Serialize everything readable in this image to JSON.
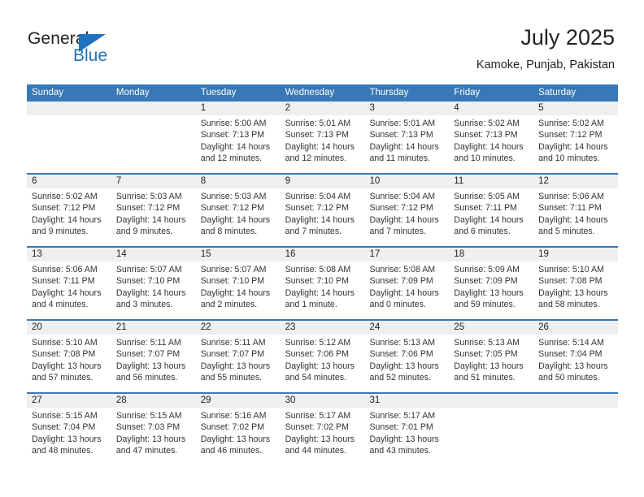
{
  "brand": {
    "name_part1": "General",
    "name_part2": "Blue",
    "flag_icon": "blue-triangle-flag",
    "accent_color": "#1f72bd"
  },
  "header": {
    "title": "July 2025",
    "subtitle": "Kamoke, Punjab, Pakistan"
  },
  "colors": {
    "header_blue": "#3878b6",
    "daynum_band": "#efefef",
    "text": "#222222"
  },
  "weekdays": [
    "Sunday",
    "Monday",
    "Tuesday",
    "Wednesday",
    "Thursday",
    "Friday",
    "Saturday"
  ],
  "weeks": [
    [
      {
        "day": "",
        "empty": true,
        "lines": []
      },
      {
        "day": "",
        "empty": true,
        "lines": []
      },
      {
        "day": "1",
        "empty": false,
        "lines": [
          "Sunrise: 5:00 AM",
          "Sunset: 7:13 PM",
          "Daylight: 14 hours",
          "and 12 minutes."
        ]
      },
      {
        "day": "2",
        "empty": false,
        "lines": [
          "Sunrise: 5:01 AM",
          "Sunset: 7:13 PM",
          "Daylight: 14 hours",
          "and 12 minutes."
        ]
      },
      {
        "day": "3",
        "empty": false,
        "lines": [
          "Sunrise: 5:01 AM",
          "Sunset: 7:13 PM",
          "Daylight: 14 hours",
          "and 11 minutes."
        ]
      },
      {
        "day": "4",
        "empty": false,
        "lines": [
          "Sunrise: 5:02 AM",
          "Sunset: 7:13 PM",
          "Daylight: 14 hours",
          "and 10 minutes."
        ]
      },
      {
        "day": "5",
        "empty": false,
        "lines": [
          "Sunrise: 5:02 AM",
          "Sunset: 7:12 PM",
          "Daylight: 14 hours",
          "and 10 minutes."
        ]
      }
    ],
    [
      {
        "day": "6",
        "empty": false,
        "lines": [
          "Sunrise: 5:02 AM",
          "Sunset: 7:12 PM",
          "Daylight: 14 hours",
          "and 9 minutes."
        ]
      },
      {
        "day": "7",
        "empty": false,
        "lines": [
          "Sunrise: 5:03 AM",
          "Sunset: 7:12 PM",
          "Daylight: 14 hours",
          "and 9 minutes."
        ]
      },
      {
        "day": "8",
        "empty": false,
        "lines": [
          "Sunrise: 5:03 AM",
          "Sunset: 7:12 PM",
          "Daylight: 14 hours",
          "and 8 minutes."
        ]
      },
      {
        "day": "9",
        "empty": false,
        "lines": [
          "Sunrise: 5:04 AM",
          "Sunset: 7:12 PM",
          "Daylight: 14 hours",
          "and 7 minutes."
        ]
      },
      {
        "day": "10",
        "empty": false,
        "lines": [
          "Sunrise: 5:04 AM",
          "Sunset: 7:12 PM",
          "Daylight: 14 hours",
          "and 7 minutes."
        ]
      },
      {
        "day": "11",
        "empty": false,
        "lines": [
          "Sunrise: 5:05 AM",
          "Sunset: 7:11 PM",
          "Daylight: 14 hours",
          "and 6 minutes."
        ]
      },
      {
        "day": "12",
        "empty": false,
        "lines": [
          "Sunrise: 5:06 AM",
          "Sunset: 7:11 PM",
          "Daylight: 14 hours",
          "and 5 minutes."
        ]
      }
    ],
    [
      {
        "day": "13",
        "empty": false,
        "lines": [
          "Sunrise: 5:06 AM",
          "Sunset: 7:11 PM",
          "Daylight: 14 hours",
          "and 4 minutes."
        ]
      },
      {
        "day": "14",
        "empty": false,
        "lines": [
          "Sunrise: 5:07 AM",
          "Sunset: 7:10 PM",
          "Daylight: 14 hours",
          "and 3 minutes."
        ]
      },
      {
        "day": "15",
        "empty": false,
        "lines": [
          "Sunrise: 5:07 AM",
          "Sunset: 7:10 PM",
          "Daylight: 14 hours",
          "and 2 minutes."
        ]
      },
      {
        "day": "16",
        "empty": false,
        "lines": [
          "Sunrise: 5:08 AM",
          "Sunset: 7:10 PM",
          "Daylight: 14 hours",
          "and 1 minute."
        ]
      },
      {
        "day": "17",
        "empty": false,
        "lines": [
          "Sunrise: 5:08 AM",
          "Sunset: 7:09 PM",
          "Daylight: 14 hours",
          "and 0 minutes."
        ]
      },
      {
        "day": "18",
        "empty": false,
        "lines": [
          "Sunrise: 5:09 AM",
          "Sunset: 7:09 PM",
          "Daylight: 13 hours",
          "and 59 minutes."
        ]
      },
      {
        "day": "19",
        "empty": false,
        "lines": [
          "Sunrise: 5:10 AM",
          "Sunset: 7:08 PM",
          "Daylight: 13 hours",
          "and 58 minutes."
        ]
      }
    ],
    [
      {
        "day": "20",
        "empty": false,
        "lines": [
          "Sunrise: 5:10 AM",
          "Sunset: 7:08 PM",
          "Daylight: 13 hours",
          "and 57 minutes."
        ]
      },
      {
        "day": "21",
        "empty": false,
        "lines": [
          "Sunrise: 5:11 AM",
          "Sunset: 7:07 PM",
          "Daylight: 13 hours",
          "and 56 minutes."
        ]
      },
      {
        "day": "22",
        "empty": false,
        "lines": [
          "Sunrise: 5:11 AM",
          "Sunset: 7:07 PM",
          "Daylight: 13 hours",
          "and 55 minutes."
        ]
      },
      {
        "day": "23",
        "empty": false,
        "lines": [
          "Sunrise: 5:12 AM",
          "Sunset: 7:06 PM",
          "Daylight: 13 hours",
          "and 54 minutes."
        ]
      },
      {
        "day": "24",
        "empty": false,
        "lines": [
          "Sunrise: 5:13 AM",
          "Sunset: 7:06 PM",
          "Daylight: 13 hours",
          "and 52 minutes."
        ]
      },
      {
        "day": "25",
        "empty": false,
        "lines": [
          "Sunrise: 5:13 AM",
          "Sunset: 7:05 PM",
          "Daylight: 13 hours",
          "and 51 minutes."
        ]
      },
      {
        "day": "26",
        "empty": false,
        "lines": [
          "Sunrise: 5:14 AM",
          "Sunset: 7:04 PM",
          "Daylight: 13 hours",
          "and 50 minutes."
        ]
      }
    ],
    [
      {
        "day": "27",
        "empty": false,
        "lines": [
          "Sunrise: 5:15 AM",
          "Sunset: 7:04 PM",
          "Daylight: 13 hours",
          "and 48 minutes."
        ]
      },
      {
        "day": "28",
        "empty": false,
        "lines": [
          "Sunrise: 5:15 AM",
          "Sunset: 7:03 PM",
          "Daylight: 13 hours",
          "and 47 minutes."
        ]
      },
      {
        "day": "29",
        "empty": false,
        "lines": [
          "Sunrise: 5:16 AM",
          "Sunset: 7:02 PM",
          "Daylight: 13 hours",
          "and 46 minutes."
        ]
      },
      {
        "day": "30",
        "empty": false,
        "lines": [
          "Sunrise: 5:17 AM",
          "Sunset: 7:02 PM",
          "Daylight: 13 hours",
          "and 44 minutes."
        ]
      },
      {
        "day": "31",
        "empty": false,
        "lines": [
          "Sunrise: 5:17 AM",
          "Sunset: 7:01 PM",
          "Daylight: 13 hours",
          "and 43 minutes."
        ]
      },
      {
        "day": "",
        "empty": true,
        "lines": []
      },
      {
        "day": "",
        "empty": true,
        "lines": []
      }
    ]
  ]
}
